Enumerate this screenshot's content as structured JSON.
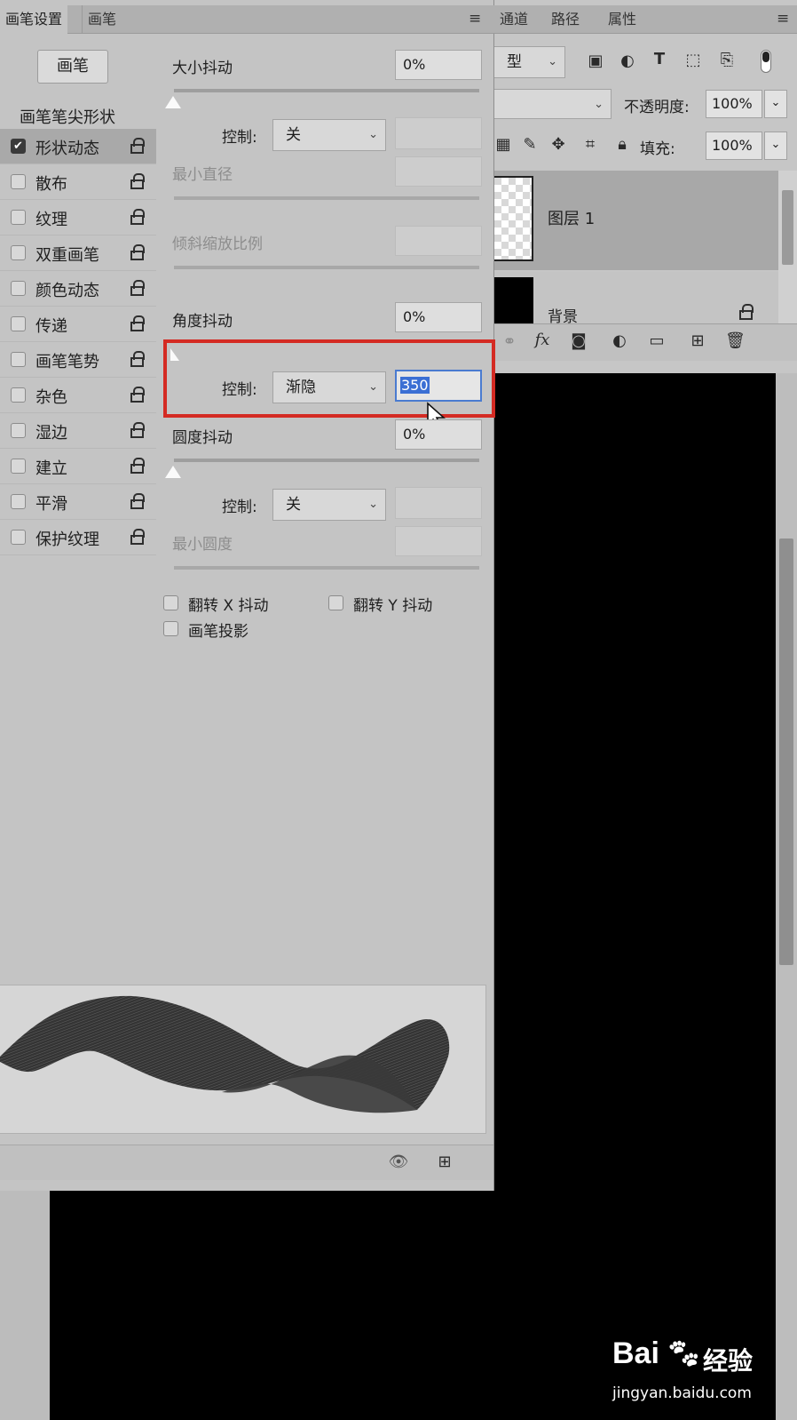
{
  "brush_panel": {
    "tabs": [
      "画笔设置",
      "画笔"
    ],
    "brush_button": "画笔",
    "tip_shape_title": "画笔笔尖形状",
    "options": [
      {
        "label": "形状动态",
        "checked": true,
        "selected": true
      },
      {
        "label": "散布",
        "checked": false,
        "selected": false
      },
      {
        "label": "纹理",
        "checked": false,
        "selected": false
      },
      {
        "label": "双重画笔",
        "checked": false,
        "selected": false
      },
      {
        "label": "颜色动态",
        "checked": false,
        "selected": false
      },
      {
        "label": "传递",
        "checked": false,
        "selected": false
      },
      {
        "label": "画笔笔势",
        "checked": false,
        "selected": false
      },
      {
        "label": "杂色",
        "checked": false,
        "selected": false
      },
      {
        "label": "湿边",
        "checked": false,
        "selected": false
      },
      {
        "label": "建立",
        "checked": false,
        "selected": false
      },
      {
        "label": "平滑",
        "checked": false,
        "selected": false
      },
      {
        "label": "保护纹理",
        "checked": false,
        "selected": false
      }
    ],
    "size_jitter": {
      "label": "大小抖动",
      "value": "0%"
    },
    "size_control": {
      "label": "控制:",
      "value": "关"
    },
    "min_diameter": {
      "label": "最小直径"
    },
    "tilt_scale": {
      "label": "倾斜缩放比例"
    },
    "angle_jitter": {
      "label": "角度抖动",
      "value": "0%"
    },
    "angle_control": {
      "label": "控制:",
      "value": "渐隐",
      "steps": "350"
    },
    "roundness_jitter": {
      "label": "圆度抖动",
      "value": "0%"
    },
    "roundness_control": {
      "label": "控制:",
      "value": "关"
    },
    "min_roundness": {
      "label": "最小圆度"
    },
    "flip_x": "翻转 X 抖动",
    "flip_y": "翻转 Y 抖动",
    "brush_projection": "画笔投影",
    "highlight_color": "#d42b23"
  },
  "layers_panel": {
    "tabs": [
      "通道",
      "路径",
      "属性"
    ],
    "filter_kind": "型",
    "opacity_label": "不透明度:",
    "opacity_value": "100%",
    "fill_label": "填充:",
    "fill_value": "100%",
    "layers": [
      {
        "name": "图层 1",
        "selected": true
      },
      {
        "name": "背景",
        "selected": false
      }
    ]
  },
  "watermark": {
    "brand": "Bai",
    "brand2": "经验",
    "url": "jingyan.baidu.com"
  }
}
